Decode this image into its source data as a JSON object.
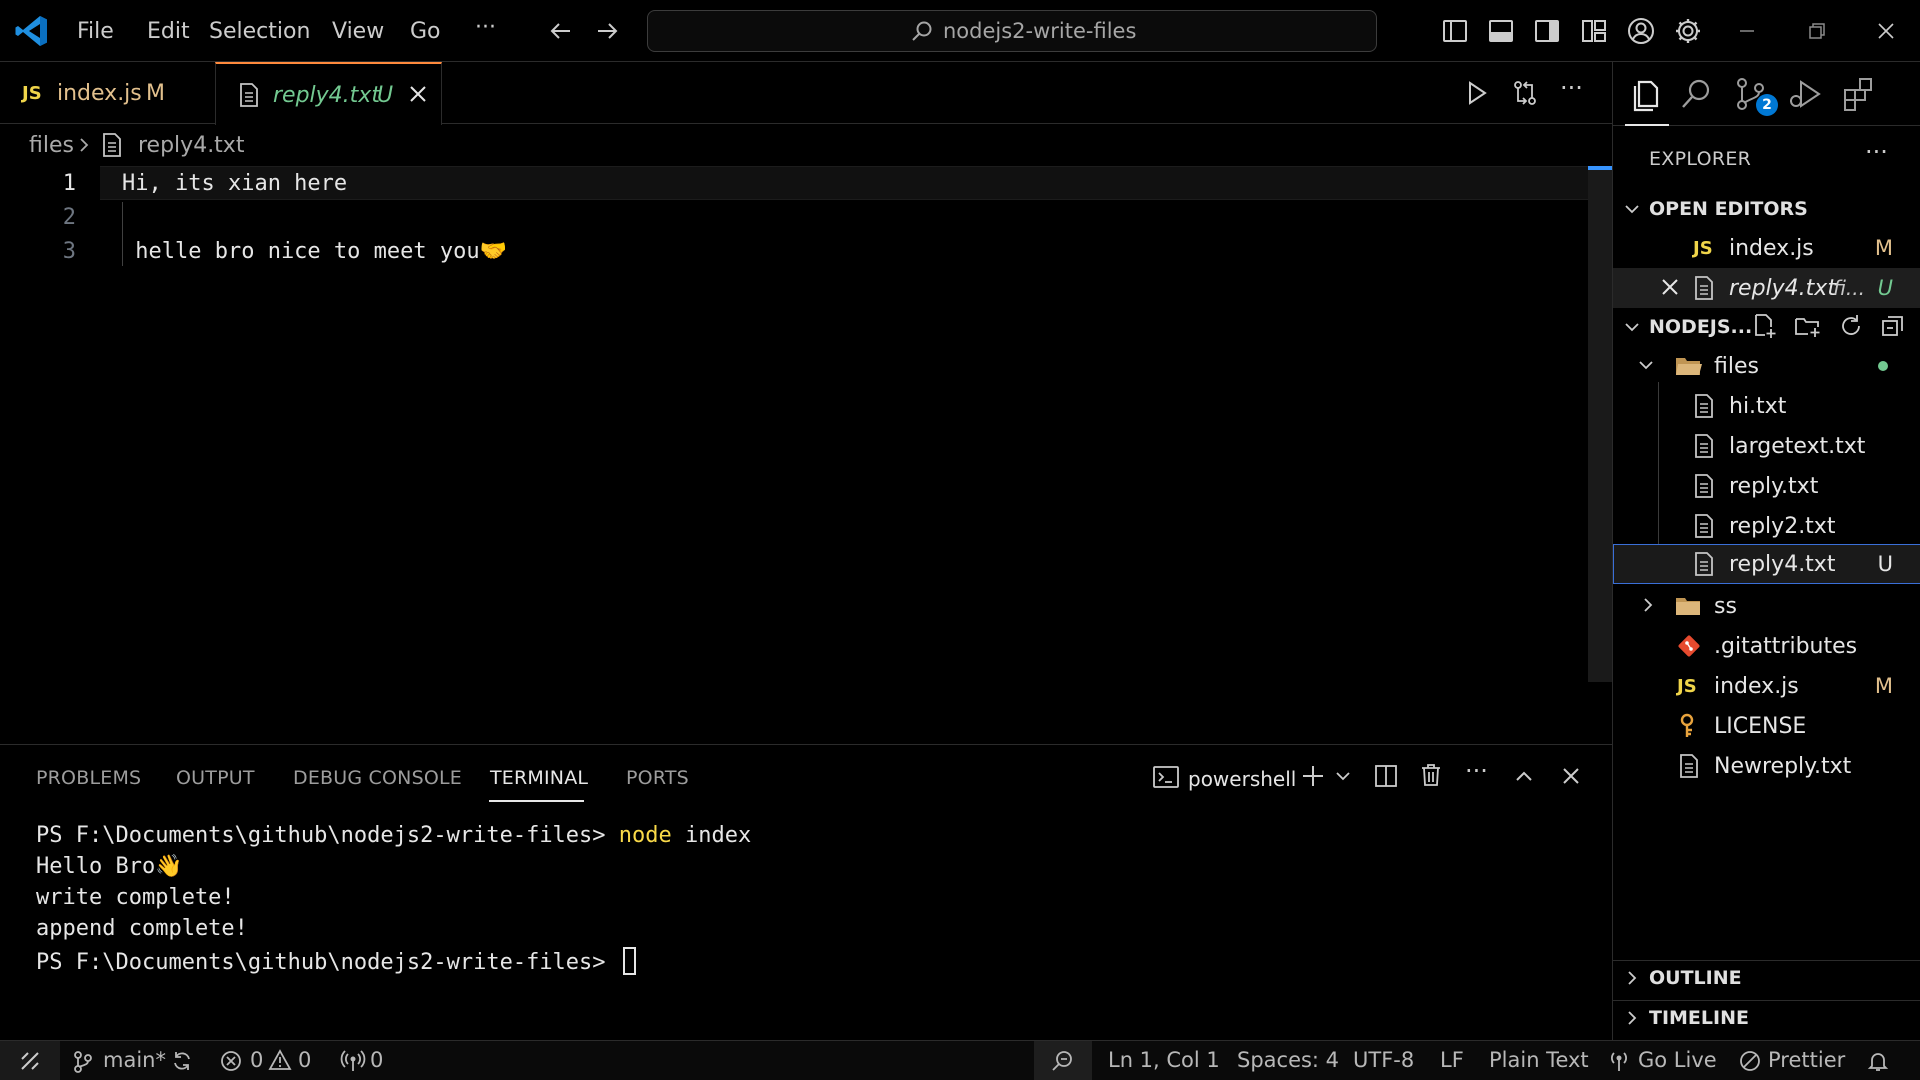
{
  "titlebar": {
    "menu": [
      "File",
      "Edit",
      "Selection",
      "View",
      "Go"
    ],
    "more": "···",
    "search_text": "nodejs2-write-files"
  },
  "tabs": [
    {
      "badge": "JS",
      "label": "index.js",
      "status": "M"
    },
    {
      "label": "reply4.txt",
      "status": "U",
      "active": true
    }
  ],
  "editor_actions": {
    "more": "···"
  },
  "breadcrumb": {
    "folder": "files",
    "file": "reply4.txt"
  },
  "editor": {
    "lines": [
      {
        "num": "1",
        "text": "Hi, its xian here"
      },
      {
        "num": "2",
        "text": ""
      },
      {
        "num": "3",
        "text": " helle bro nice to meet you🤝"
      }
    ]
  },
  "panel": {
    "tabs": [
      "PROBLEMS",
      "OUTPUT",
      "DEBUG CONSOLE",
      "TERMINAL",
      "PORTS"
    ],
    "active_tab": "TERMINAL",
    "shell": "powershell",
    "more": "···",
    "terminal": {
      "prompt1": "PS F:\\Documents\\github\\nodejs2-write-files> ",
      "cmd_node": "node",
      "cmd_arg": " index",
      "out1": "Hello Bro👋",
      "out2": "write complete!",
      "out3": "append complete!",
      "prompt2": "PS F:\\Documents\\github\\nodejs2-write-files> "
    }
  },
  "activity": {
    "scm_badge": "2"
  },
  "sidebar": {
    "title": "EXPLORER",
    "more": "···",
    "open_editors": {
      "header": "OPEN EDITORS",
      "items": [
        {
          "badge": "JS",
          "label": "index.js",
          "status": "M"
        },
        {
          "label": "reply4.txt",
          "hint": "fi...",
          "status": "U"
        }
      ]
    },
    "project": {
      "header": "NODEJS...",
      "files_folder": "files",
      "children": [
        "hi.txt",
        "largetext.txt",
        "reply.txt",
        "reply2.txt",
        "reply4.txt"
      ],
      "child_status_reply4": "U",
      "ss_folder": "ss",
      "gitattributes": ".gitattributes",
      "index_badge": "JS",
      "index": "index.js",
      "index_status": "M",
      "license": "LICENSE",
      "newreply": "Newreply.txt"
    },
    "outline": "OUTLINE",
    "timeline": "TIMELINE"
  },
  "statusbar": {
    "branch": "main*",
    "errors": "0",
    "warnings": "0",
    "ports": "0",
    "position": "Ln 1, Col 1",
    "spaces": "Spaces: 4",
    "encoding": "UTF-8",
    "eol": "LF",
    "language": "Plain Text",
    "golive": "Go Live",
    "prettier": "Prettier"
  },
  "colors": {
    "accent_tab_top": "#ff8a3d",
    "modified": "#e2c08d",
    "untracked": "#73c991",
    "badge_blue": "#0078d4",
    "terminal_command": "#f9d949"
  }
}
